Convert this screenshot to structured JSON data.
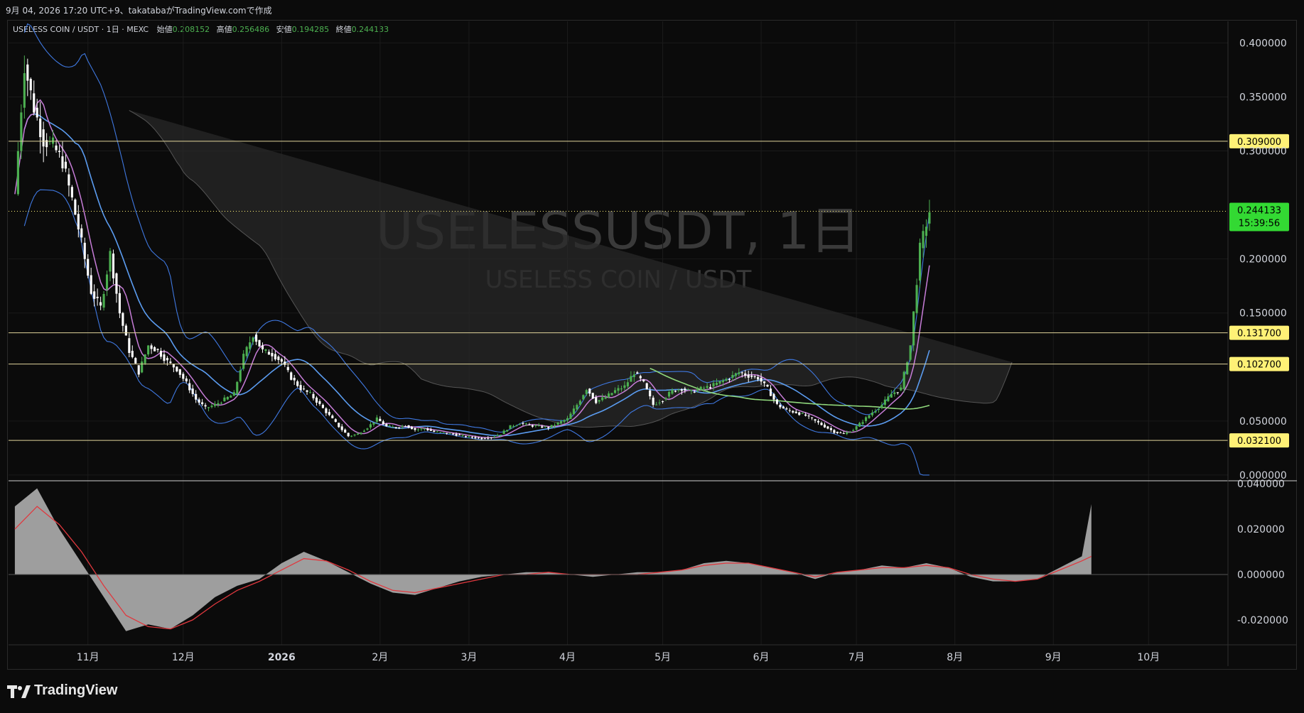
{
  "header": {
    "caption": "9月 04, 2026 17:20 UTC+9、takatabaがTradingView.comで作成"
  },
  "legend": {
    "symbol_line": "USELESS COIN / USDT · 1日 · MEXC",
    "open_label": "始値",
    "open_value": "0.208152",
    "high_label": "高値",
    "high_value": "0.256486",
    "low_label": "安値",
    "low_value": "0.194285",
    "close_label": "終値",
    "close_value": "0.244133"
  },
  "watermark": {
    "title": "USELESSUSDT, 1日",
    "subtitle": "USELESS COIN / USDT"
  },
  "footer": {
    "brand": "TradingView"
  },
  "colors": {
    "background": "#0b0b0b",
    "grid": "#1b1b1b",
    "bull": "#4caf50",
    "bull_bright": "#3ee03e",
    "bear": "#ffffff",
    "level_line": "#e0d49a",
    "level_tag": "#fff176",
    "price_tag": "#33d933",
    "sma_fast": "#c77dd8",
    "sma_mid": "#5b9cf0",
    "bollinger": "#3f78e0",
    "sma_long": "#90d87c",
    "cloud": "#555555",
    "histogram": "#9e9e9e",
    "signal": "#e0383e"
  },
  "chart_data": {
    "type": "candlestick",
    "symbol": "USELESS COIN / USDT",
    "timeframe": "1日",
    "exchange": "MEXC",
    "ohlc_last": {
      "open": 0.208152,
      "high": 0.256486,
      "low": 0.194285,
      "close": 0.244133
    },
    "current_price": {
      "value": "0.244133",
      "countdown": "15:39:56"
    },
    "y_axis": {
      "ticks": [
        "0.400000",
        "0.350000",
        "0.300000",
        "0.200000",
        "0.150000",
        "0.050000",
        "0.000000"
      ],
      "range": [
        -0.004,
        0.42
      ]
    },
    "x_axis": {
      "ticks": [
        "11月",
        "12月",
        "2026",
        "2月",
        "3月",
        "4月",
        "5月",
        "6月",
        "7月",
        "8月",
        "9月",
        "10月"
      ]
    },
    "horizontal_levels": [
      "0.309000",
      "0.131700",
      "0.102700",
      "0.032100"
    ],
    "price_series": {
      "days": [
        0,
        3,
        6,
        9,
        12,
        15,
        18,
        21,
        24,
        27,
        30,
        33,
        36,
        39,
        42,
        45,
        48,
        51,
        54,
        57,
        60,
        63,
        66,
        69,
        72,
        75,
        78,
        81,
        84,
        87,
        90,
        93,
        96,
        99,
        102,
        105,
        108,
        111,
        114,
        117,
        120,
        123,
        126,
        129,
        132,
        135,
        138,
        141,
        144,
        147,
        150,
        153,
        156,
        159,
        162,
        165,
        168,
        171,
        174,
        177,
        180,
        183,
        186,
        189,
        192,
        195,
        198,
        201,
        204,
        207,
        210,
        213,
        216,
        219,
        222,
        225,
        228,
        231,
        234,
        237,
        240,
        243,
        246,
        249,
        252,
        255,
        258,
        261,
        264,
        267,
        270,
        273,
        276,
        279,
        282,
        285,
        288,
        291,
        294,
        297,
        300,
        303,
        306,
        309,
        312,
        315,
        318,
        321,
        324,
        327,
        330,
        333,
        336,
        339
      ],
      "close": [
        0.26,
        0.38,
        0.34,
        0.31,
        0.305,
        0.29,
        0.255,
        0.215,
        0.17,
        0.155,
        0.205,
        0.15,
        0.115,
        0.095,
        0.12,
        0.115,
        0.105,
        0.098,
        0.085,
        0.07,
        0.062,
        0.065,
        0.07,
        0.075,
        0.11,
        0.13,
        0.115,
        0.112,
        0.105,
        0.09,
        0.08,
        0.075,
        0.065,
        0.055,
        0.045,
        0.036,
        0.038,
        0.044,
        0.052,
        0.045,
        0.044,
        0.046,
        0.042,
        0.043,
        0.04,
        0.039,
        0.038,
        0.036,
        0.035,
        0.034,
        0.035,
        0.038,
        0.045,
        0.048,
        0.046,
        0.045,
        0.044,
        0.048,
        0.052,
        0.065,
        0.08,
        0.068,
        0.072,
        0.078,
        0.082,
        0.095,
        0.085,
        0.065,
        0.07,
        0.078,
        0.08,
        0.077,
        0.08,
        0.082,
        0.086,
        0.09,
        0.095,
        0.092,
        0.09,
        0.08,
        0.065,
        0.06,
        0.058,
        0.055,
        0.05,
        0.045,
        0.04,
        0.038,
        0.042,
        0.05,
        0.058,
        0.065,
        0.075,
        0.08,
        0.12,
        0.21,
        0.244133
      ]
    },
    "oscillator": {
      "ticks": [
        "0.040000",
        "0.020000",
        "0.000000",
        "-0.020000"
      ],
      "range": [
        -0.031,
        0.041
      ],
      "days": [
        0,
        7,
        14,
        21,
        28,
        35,
        42,
        49,
        56,
        63,
        70,
        77,
        84,
        91,
        98,
        105,
        112,
        119,
        126,
        133,
        140,
        147,
        154,
        161,
        168,
        175,
        182,
        189,
        196,
        203,
        210,
        217,
        224,
        231,
        238,
        245,
        252,
        259,
        266,
        273,
        280,
        287,
        294,
        301,
        308,
        315,
        322,
        329,
        336,
        339
      ],
      "histogram": [
        0.03,
        0.038,
        0.02,
        0.005,
        -0.01,
        -0.025,
        -0.022,
        -0.024,
        -0.018,
        -0.01,
        -0.005,
        -0.002,
        0.005,
        0.01,
        0.006,
        0.001,
        -0.004,
        -0.008,
        -0.009,
        -0.006,
        -0.003,
        -0.001,
        0.0,
        0.001,
        0.001,
        0.0,
        -0.001,
        0.0,
        0.001,
        0.001,
        0.002,
        0.005,
        0.006,
        0.005,
        0.003,
        0.001,
        -0.002,
        0.001,
        0.002,
        0.004,
        0.003,
        0.005,
        0.003,
        -0.001,
        -0.003,
        -0.003,
        -0.002,
        0.003,
        0.008,
        0.031
      ],
      "signal": [
        0.02,
        0.03,
        0.022,
        0.01,
        -0.005,
        -0.018,
        -0.023,
        -0.024,
        -0.02,
        -0.013,
        -0.007,
        -0.003,
        0.002,
        0.007,
        0.006,
        0.002,
        -0.003,
        -0.007,
        -0.008,
        -0.006,
        -0.004,
        -0.002,
        0.0,
        0.0,
        0.001,
        0.0,
        0.0,
        0.0,
        0.0,
        0.001,
        0.002,
        0.004,
        0.005,
        0.005,
        0.003,
        0.001,
        -0.001,
        0.001,
        0.002,
        0.003,
        0.003,
        0.004,
        0.003,
        0.0,
        -0.002,
        -0.003,
        -0.002,
        0.002,
        0.006,
        0.008
      ]
    }
  }
}
